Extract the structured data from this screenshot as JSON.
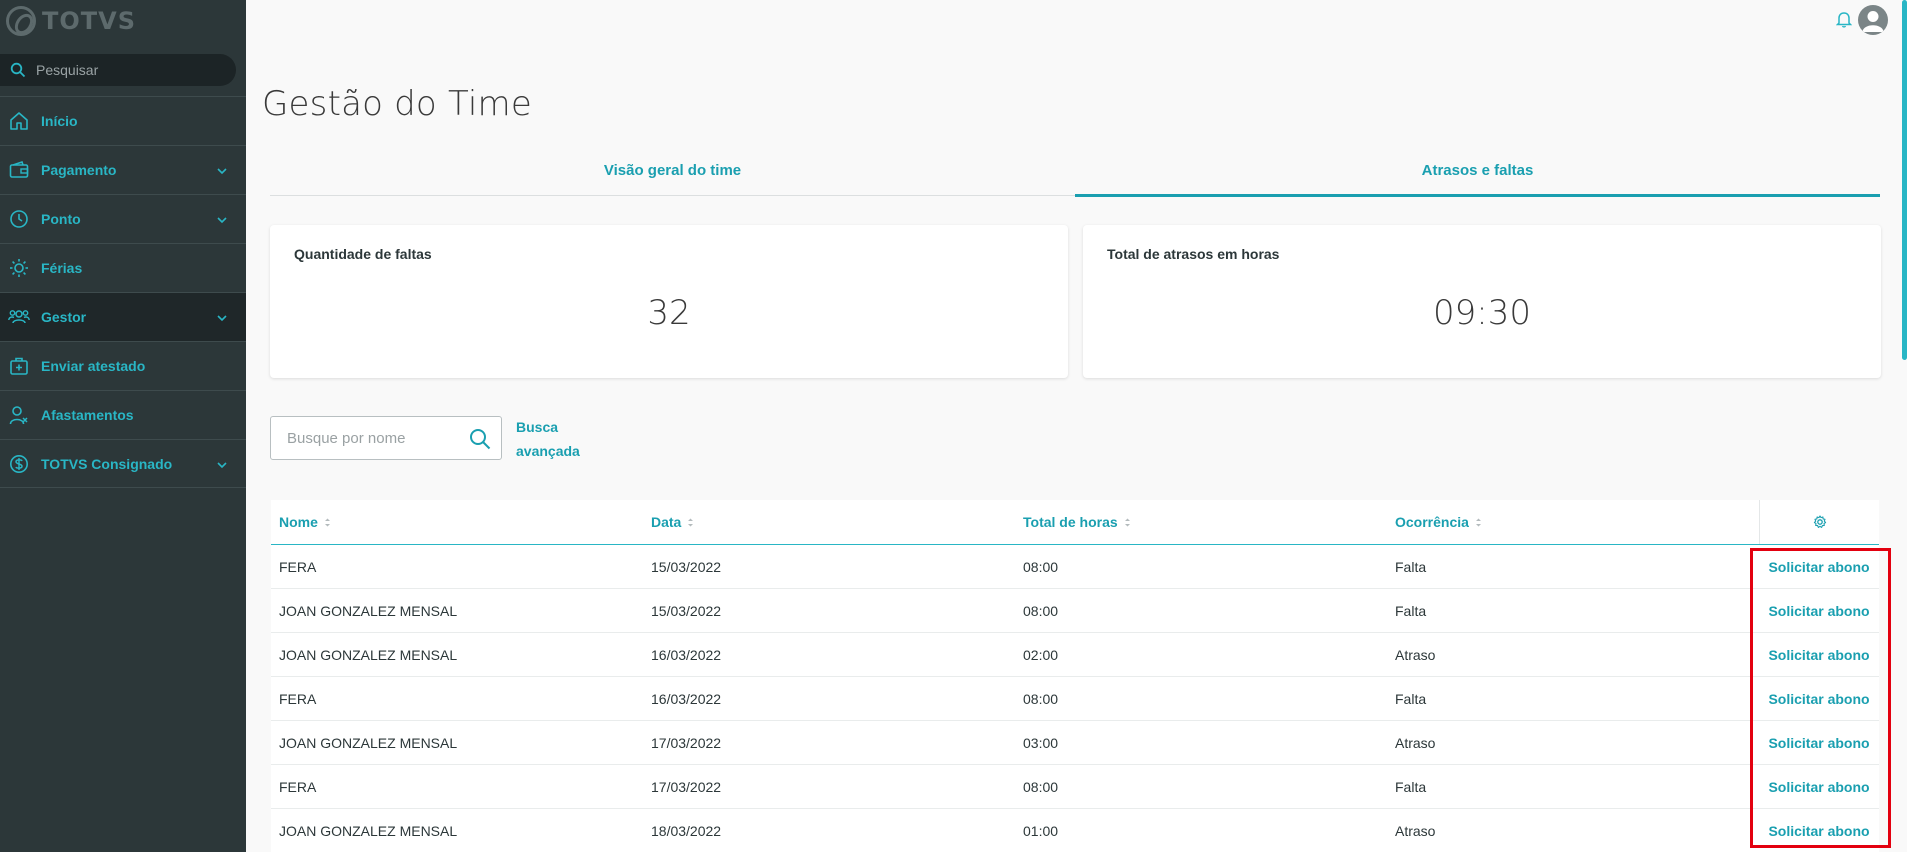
{
  "brand": {
    "name": "TOTVS"
  },
  "sidebar": {
    "search_placeholder": "Pesquisar",
    "items": [
      {
        "label": "Início",
        "icon": "home-icon",
        "has_chevron": false
      },
      {
        "label": "Pagamento",
        "icon": "wallet-icon",
        "has_chevron": true
      },
      {
        "label": "Ponto",
        "icon": "clock-icon",
        "has_chevron": true
      },
      {
        "label": "Férias",
        "icon": "sun-icon",
        "has_chevron": false
      },
      {
        "label": "Gestor",
        "icon": "team-icon",
        "has_chevron": true,
        "active": true
      },
      {
        "label": "Enviar atestado",
        "icon": "medical-kit-icon",
        "has_chevron": false
      },
      {
        "label": "Afastamentos",
        "icon": "user-remove-icon",
        "has_chevron": false
      },
      {
        "label": "TOTVS Consignado",
        "icon": "dollar-circle-icon",
        "has_chevron": true
      }
    ]
  },
  "header": {
    "notifications_icon": "bell-icon",
    "avatar_icon": "user-avatar-icon"
  },
  "page": {
    "title": "Gestão do Time",
    "tabs": [
      {
        "label": "Visão geral do time",
        "active": false
      },
      {
        "label": "Atrasos e faltas",
        "active": true
      }
    ]
  },
  "cards": {
    "absences": {
      "label": "Quantidade de faltas",
      "value": "32"
    },
    "delays": {
      "label": "Total de atrasos em horas",
      "value": "09:30"
    }
  },
  "filter": {
    "search_placeholder": "Busque por nome",
    "advanced_search_line1": "Busca",
    "advanced_search_line2": "avançada"
  },
  "table": {
    "columns": [
      "Nome",
      "Data",
      "Total de horas",
      "Ocorrência"
    ],
    "settings_icon": "gear-icon",
    "action_label": "Solicitar abono",
    "rows": [
      {
        "nome": "FERA",
        "data": "15/03/2022",
        "horas": "08:00",
        "ocorrencia": "Falta"
      },
      {
        "nome": "JOAN GONZALEZ MENSAL",
        "data": "15/03/2022",
        "horas": "08:00",
        "ocorrencia": "Falta"
      },
      {
        "nome": "JOAN GONZALEZ MENSAL",
        "data": "16/03/2022",
        "horas": "02:00",
        "ocorrencia": "Atraso"
      },
      {
        "nome": "FERA",
        "data": "16/03/2022",
        "horas": "08:00",
        "ocorrencia": "Falta"
      },
      {
        "nome": "JOAN GONZALEZ MENSAL",
        "data": "17/03/2022",
        "horas": "03:00",
        "ocorrencia": "Atraso"
      },
      {
        "nome": "FERA",
        "data": "17/03/2022",
        "horas": "08:00",
        "ocorrencia": "Falta"
      },
      {
        "nome": "JOAN GONZALEZ MENSAL",
        "data": "18/03/2022",
        "horas": "01:00",
        "ocorrencia": "Atraso"
      }
    ]
  },
  "colors": {
    "sidebar_bg": "#2c3739",
    "accent": "#1a9fb0",
    "highlight_box": "#e3000f"
  }
}
